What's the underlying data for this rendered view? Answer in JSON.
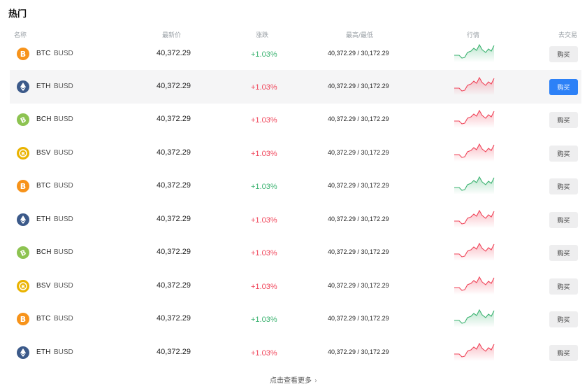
{
  "title": "热门",
  "columns": {
    "name": "名称",
    "price": "最新价",
    "change": "涨跌",
    "high_low": "最高/最低",
    "trend": "行情",
    "trade": "去交易"
  },
  "colors": {
    "up": "#3cb371",
    "down": "#f0455a",
    "buy_active": "#2d81f7",
    "btc": "#f7931a",
    "eth": "#3c5a8a",
    "bch": "#8dc351",
    "bsv": "#eab300"
  },
  "rows": [
    {
      "base": "BTC",
      "quote": "BUSD",
      "icon": "bitcoin-icon",
      "price": "40,372.29",
      "change": "+1.03%",
      "direction": "up",
      "high_low": "40,372.29 / 30,172.29",
      "buy_label": "购买"
    },
    {
      "base": "ETH",
      "quote": "BUSD",
      "icon": "ethereum-icon",
      "price": "40,372.29",
      "change": "+1.03%",
      "direction": "down",
      "high_low": "40,372.29 / 30,172.29",
      "buy_label": "购买"
    },
    {
      "base": "BCH",
      "quote": "BUSD",
      "icon": "bitcoin-cash-icon",
      "price": "40,372.29",
      "change": "+1.03%",
      "direction": "down",
      "high_low": "40,372.29 / 30,172.29",
      "buy_label": "购买"
    },
    {
      "base": "BSV",
      "quote": "BUSD",
      "icon": "bitcoin-sv-icon",
      "price": "40,372.29",
      "change": "+1.03%",
      "direction": "down",
      "high_low": "40,372.29 / 30,172.29",
      "buy_label": "购买"
    },
    {
      "base": "BTC",
      "quote": "BUSD",
      "icon": "bitcoin-icon",
      "price": "40,372.29",
      "change": "+1.03%",
      "direction": "up",
      "high_low": "40,372.29 / 30,172.29",
      "buy_label": "购买"
    },
    {
      "base": "ETH",
      "quote": "BUSD",
      "icon": "ethereum-icon",
      "price": "40,372.29",
      "change": "+1.03%",
      "direction": "down",
      "high_low": "40,372.29 / 30,172.29",
      "buy_label": "购买"
    },
    {
      "base": "BCH",
      "quote": "BUSD",
      "icon": "bitcoin-cash-icon",
      "price": "40,372.29",
      "change": "+1.03%",
      "direction": "down",
      "high_low": "40,372.29 / 30,172.29",
      "buy_label": "购买"
    },
    {
      "base": "BSV",
      "quote": "BUSD",
      "icon": "bitcoin-sv-icon",
      "price": "40,372.29",
      "change": "+1.03%",
      "direction": "down",
      "high_low": "40,372.29 / 30,172.29",
      "buy_label": "购买"
    },
    {
      "base": "BTC",
      "quote": "BUSD",
      "icon": "bitcoin-icon",
      "price": "40,372.29",
      "change": "+1.03%",
      "direction": "up",
      "high_low": "40,372.29 / 30,172.29",
      "buy_label": "购买"
    },
    {
      "base": "ETH",
      "quote": "BUSD",
      "icon": "ethereum-icon",
      "price": "40,372.29",
      "change": "+1.03%",
      "direction": "down",
      "high_low": "40,372.29 / 30,172.29",
      "buy_label": "购买"
    }
  ],
  "hover_row_index": 1,
  "more_label": "点击查看更多"
}
